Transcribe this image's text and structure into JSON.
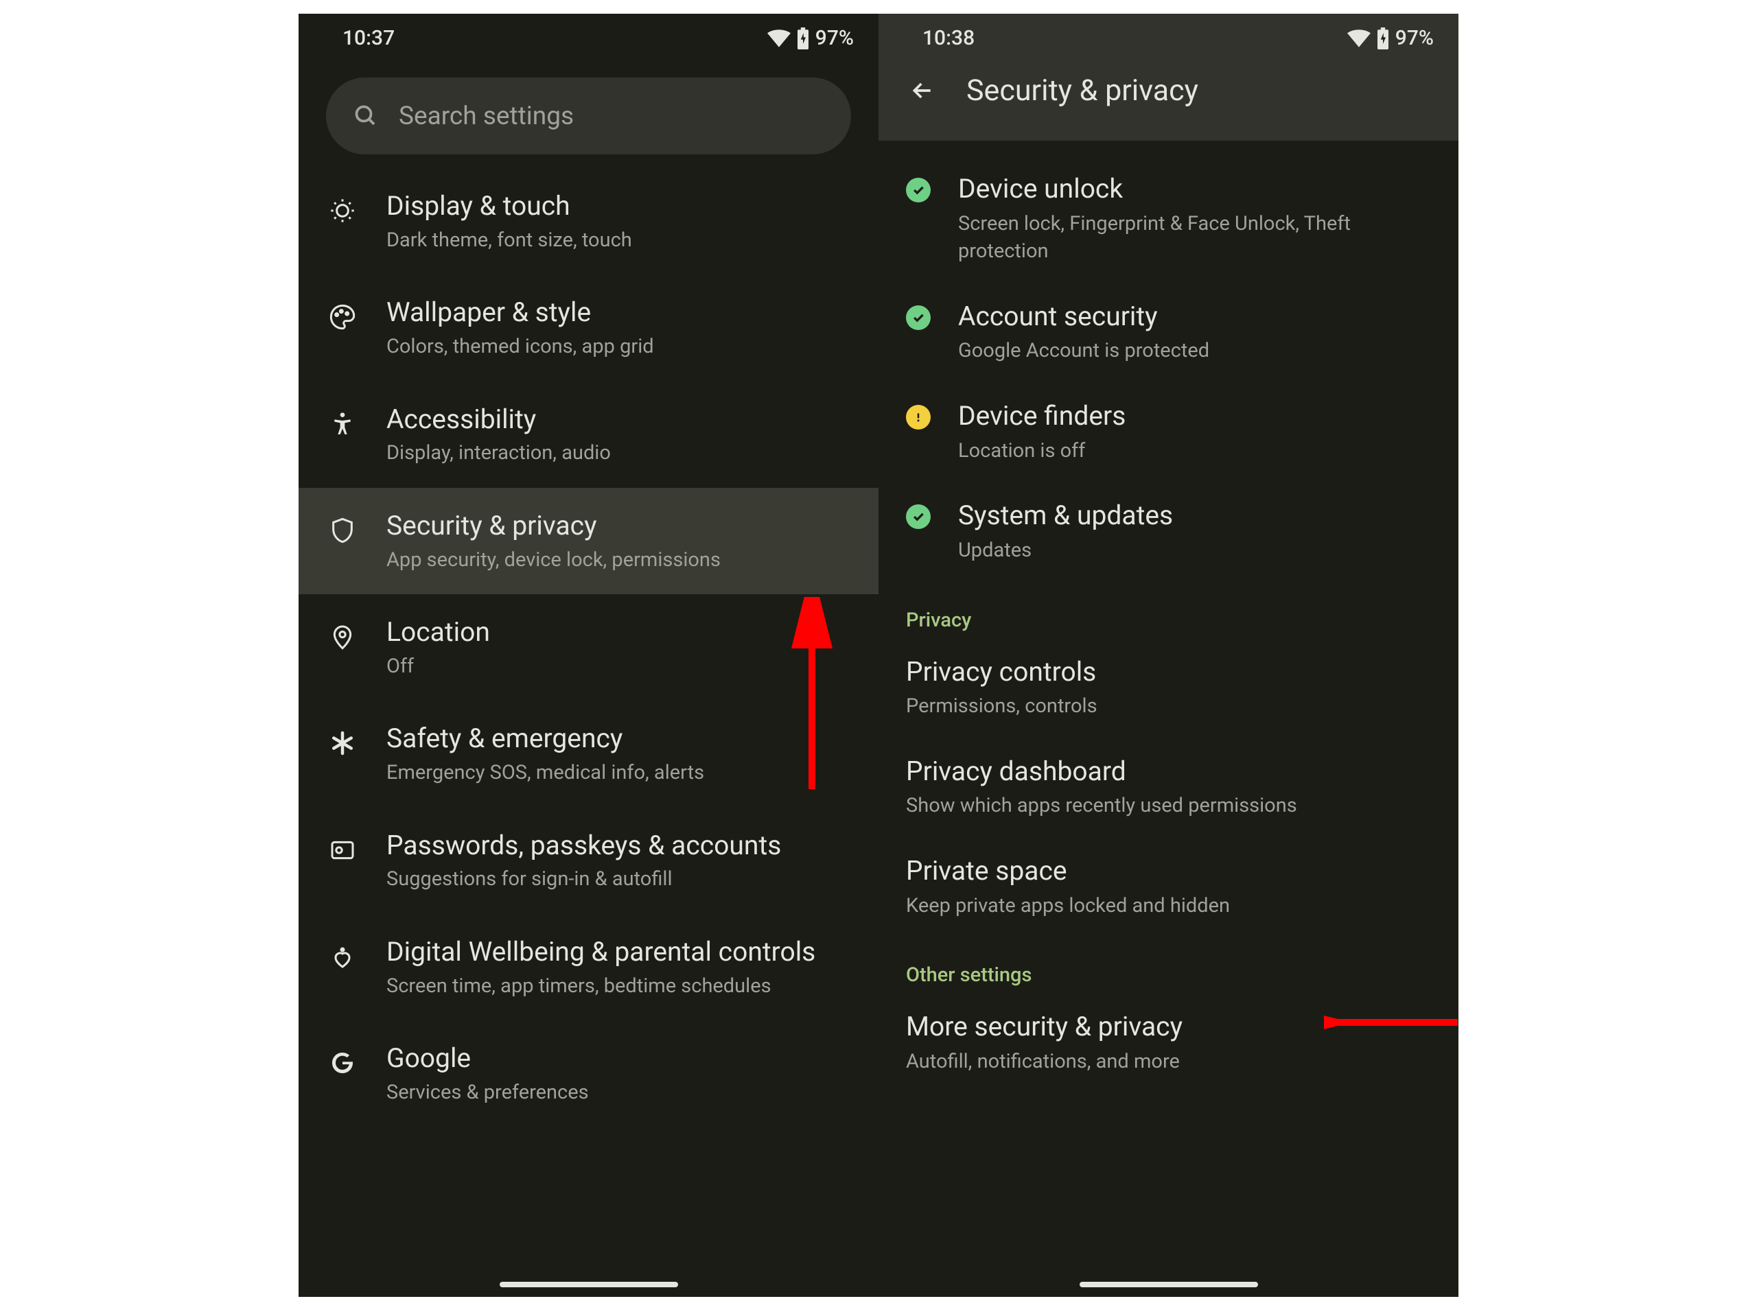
{
  "left": {
    "status": {
      "time": "10:37",
      "battery": "97%"
    },
    "search_placeholder": "Search settings",
    "items": [
      {
        "icon": "brightness",
        "title": "Display & touch",
        "subtitle": "Dark theme, font size, touch"
      },
      {
        "icon": "palette",
        "title": "Wallpaper & style",
        "subtitle": "Colors, themed icons, app grid"
      },
      {
        "icon": "accessibility",
        "title": "Accessibility",
        "subtitle": "Display, interaction, audio"
      },
      {
        "icon": "shield",
        "title": "Security & privacy",
        "subtitle": "App security, device lock, permissions",
        "highlight": true
      },
      {
        "icon": "location",
        "title": "Location",
        "subtitle": "Off"
      },
      {
        "icon": "asterisk",
        "title": "Safety & emergency",
        "subtitle": "Emergency SOS, medical info, alerts"
      },
      {
        "icon": "key",
        "title": "Passwords, passkeys & accounts",
        "subtitle": "Suggestions for sign-in & autofill"
      },
      {
        "icon": "wellbeing",
        "title": "Digital Wellbeing & parental controls",
        "subtitle": "Screen time, app timers, bedtime schedules"
      },
      {
        "icon": "google",
        "title": "Google",
        "subtitle": "Services & preferences"
      }
    ]
  },
  "right": {
    "status": {
      "time": "10:38",
      "battery": "97%"
    },
    "header_title": "Security & privacy",
    "status_items": [
      {
        "dot": "green",
        "title": "Device unlock",
        "subtitle": "Screen lock, Fingerprint & Face Unlock, Theft protection"
      },
      {
        "dot": "green",
        "title": "Account security",
        "subtitle": "Google Account is protected"
      },
      {
        "dot": "yellow",
        "title": "Device finders",
        "subtitle": "Location is off"
      },
      {
        "dot": "green",
        "title": "System & updates",
        "subtitle": "Updates"
      }
    ],
    "privacy_label": "Privacy",
    "privacy_items": [
      {
        "title": "Privacy controls",
        "subtitle": "Permissions, controls"
      },
      {
        "title": "Privacy dashboard",
        "subtitle": "Show which apps recently used permissions"
      },
      {
        "title": "Private space",
        "subtitle": "Keep private apps locked and hidden"
      }
    ],
    "other_label": "Other settings",
    "other_items": [
      {
        "title": "More security & privacy",
        "subtitle": "Autofill, notifications, and more"
      }
    ]
  }
}
